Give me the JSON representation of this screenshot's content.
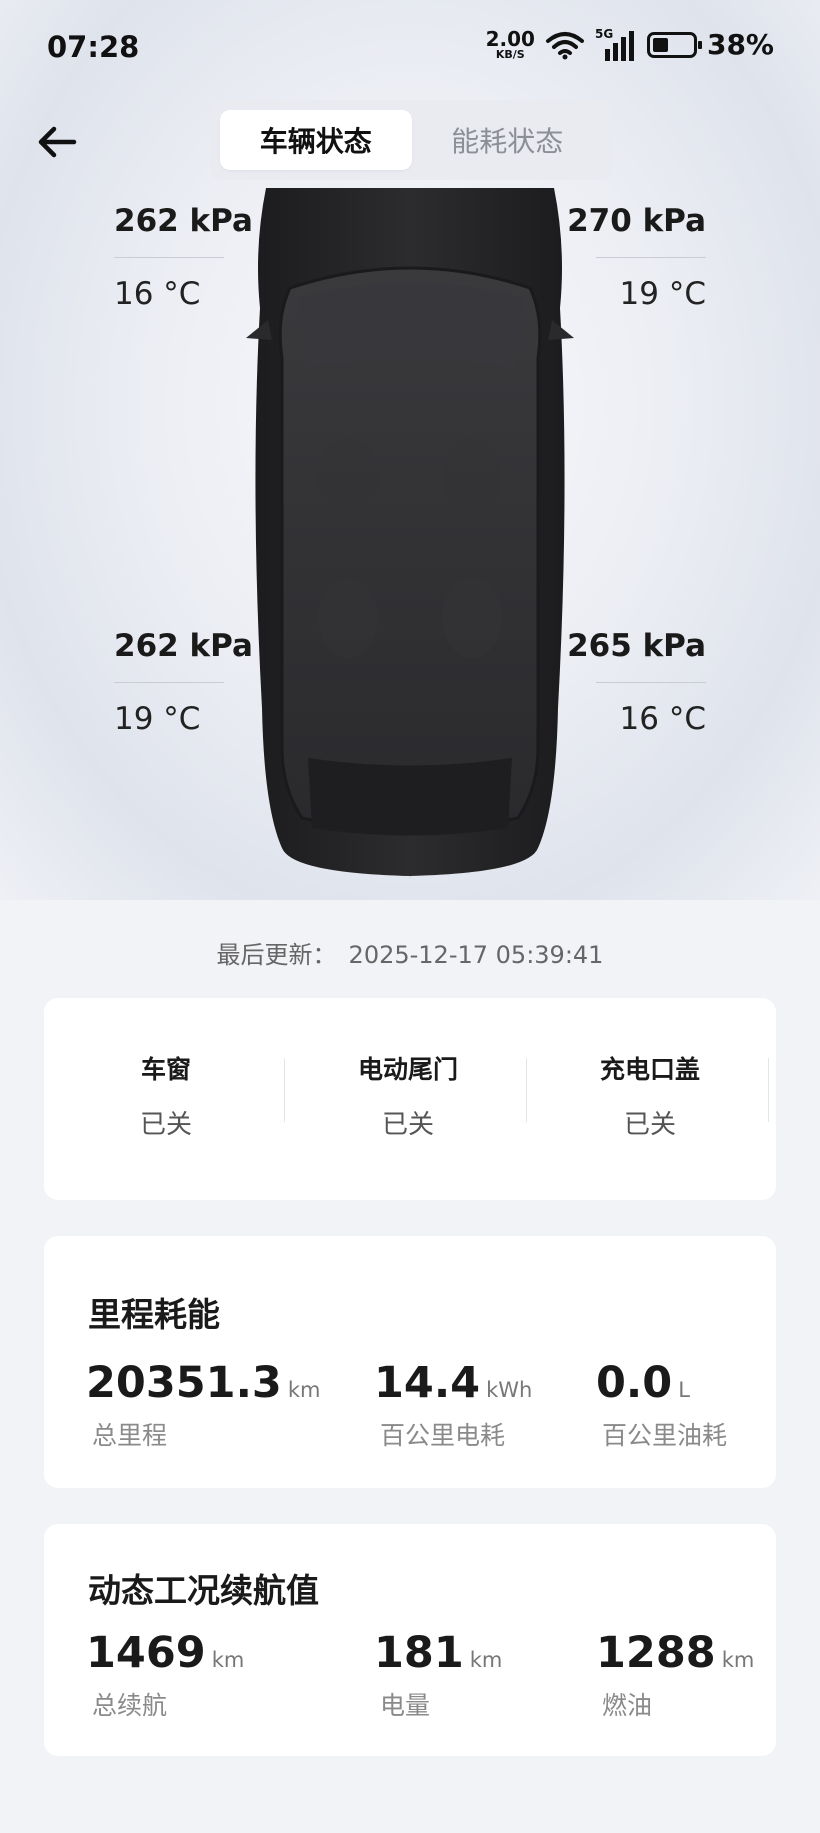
{
  "status_bar": {
    "time": "07:28",
    "net_speed_value": "2.00",
    "net_speed_unit": "KB/S",
    "network_type": "5G",
    "battery_percent": "38%"
  },
  "nav": {
    "back_icon": "arrow-left-icon",
    "tabs": [
      {
        "label": "车辆状态",
        "active": true
      },
      {
        "label": "能耗状态",
        "active": false
      }
    ]
  },
  "tires": {
    "front_left": {
      "pressure": "262 kPa",
      "temperature": "16 °C"
    },
    "front_right": {
      "pressure": "270 kPa",
      "temperature": "19 °C"
    },
    "rear_left": {
      "pressure": "262 kPa",
      "temperature": "19 °C"
    },
    "rear_right": {
      "pressure": "265 kPa",
      "temperature": "16 °C"
    }
  },
  "last_update": {
    "label": "最后更新：",
    "value": "2025-12-17 05:39:41"
  },
  "closures": [
    {
      "title": "车窗",
      "status": "已关"
    },
    {
      "title": "电动尾门",
      "status": "已关"
    },
    {
      "title": "充电口盖",
      "status": "已关"
    }
  ],
  "mileage": {
    "title": "里程耗能",
    "stats": [
      {
        "value": "20351.3",
        "unit": "km",
        "label": "总里程"
      },
      {
        "value": "14.4",
        "unit": "kWh",
        "label": "百公里电耗"
      },
      {
        "value": "0.0",
        "unit": "L",
        "label": "百公里油耗"
      }
    ]
  },
  "range": {
    "title": "动态工况续航值",
    "stats": [
      {
        "value": "1469",
        "unit": "km",
        "label": "总续航"
      },
      {
        "value": "181",
        "unit": "km",
        "label": "电量"
      },
      {
        "value": "1288",
        "unit": "km",
        "label": "燃油"
      }
    ]
  }
}
